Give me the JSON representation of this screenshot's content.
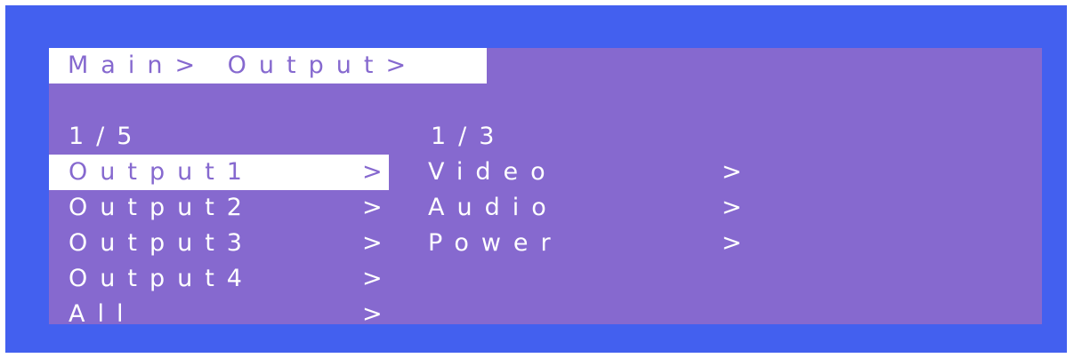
{
  "colors": {
    "bezel": "#4360ef",
    "screen": "#8669cf",
    "text": "#ffffff",
    "highlight": "#ffffff"
  },
  "breadcrumb": "Main> Output>",
  "left_panel": {
    "page": "1/5",
    "items": [
      {
        "label": "Output1",
        "arrow": ">",
        "selected": true
      },
      {
        "label": "Output2",
        "arrow": ">",
        "selected": false
      },
      {
        "label": "Output3",
        "arrow": ">",
        "selected": false
      },
      {
        "label": "Output4",
        "arrow": ">",
        "selected": false
      },
      {
        "label": "All",
        "arrow": ">",
        "selected": false
      }
    ]
  },
  "right_panel": {
    "page": "1/3",
    "items": [
      {
        "label": "Video",
        "arrow": ">"
      },
      {
        "label": "Audio",
        "arrow": ">"
      },
      {
        "label": "Power",
        "arrow": ">"
      }
    ]
  }
}
